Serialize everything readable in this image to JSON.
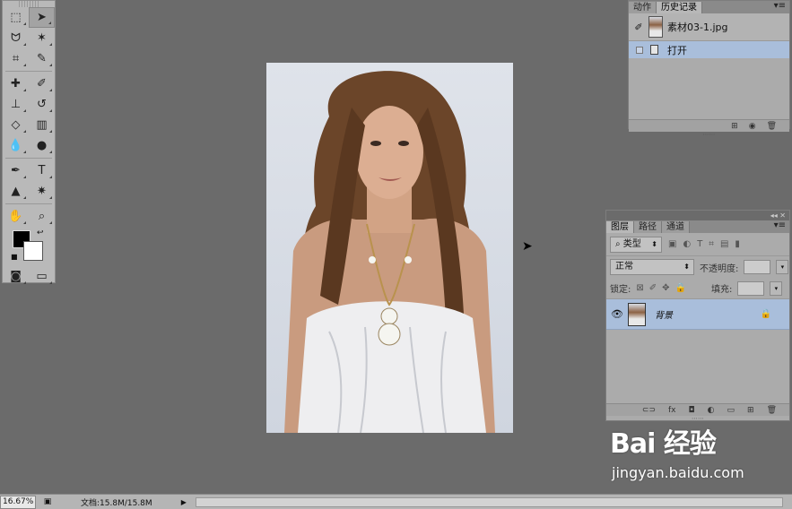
{
  "toolbox": {
    "rows": [
      [
        "marquee-icon",
        "move-icon"
      ],
      [
        "lasso-icon",
        "magic-wand-icon"
      ],
      [
        "crop-icon",
        "eyedropper-icon"
      ],
      [
        "healing-brush-icon",
        "brush-icon"
      ],
      [
        "clone-stamp-icon",
        "history-brush-icon"
      ],
      [
        "eraser-icon",
        "gradient-icon"
      ],
      [
        "blur-icon",
        "dodge-icon"
      ],
      [
        "pen-icon",
        "type-icon"
      ],
      [
        "path-select-icon",
        "shape-icon"
      ],
      [
        "hand-icon",
        "zoom-icon"
      ]
    ],
    "colors": {
      "foreground": "#000000",
      "background": "#ffffff"
    }
  },
  "history_panel": {
    "tabs": [
      "动作",
      "历史记录"
    ],
    "active_tab": "历史记录",
    "snapshot_name": "素材03-1.jpg",
    "items": [
      "打开"
    ]
  },
  "layers_panel": {
    "tabs": [
      "图层",
      "路径",
      "通道"
    ],
    "filter_kind": "类型",
    "blend_mode": "正常",
    "opacity_label": "不透明度:",
    "lock_label": "锁定:",
    "fill_label": "填充:",
    "layers": [
      {
        "name": "背景",
        "locked": true,
        "visible": true
      }
    ]
  },
  "statusbar": {
    "zoom": "16.67%",
    "doc_info": "文档:15.8M/15.8M"
  },
  "watermark": {
    "logo": "Bai 经验",
    "url": "jingyan.baidu.com"
  },
  "colors": {
    "workspace": "#6b6b6b",
    "panel": "#ababab",
    "selection": "#a9bedb"
  }
}
